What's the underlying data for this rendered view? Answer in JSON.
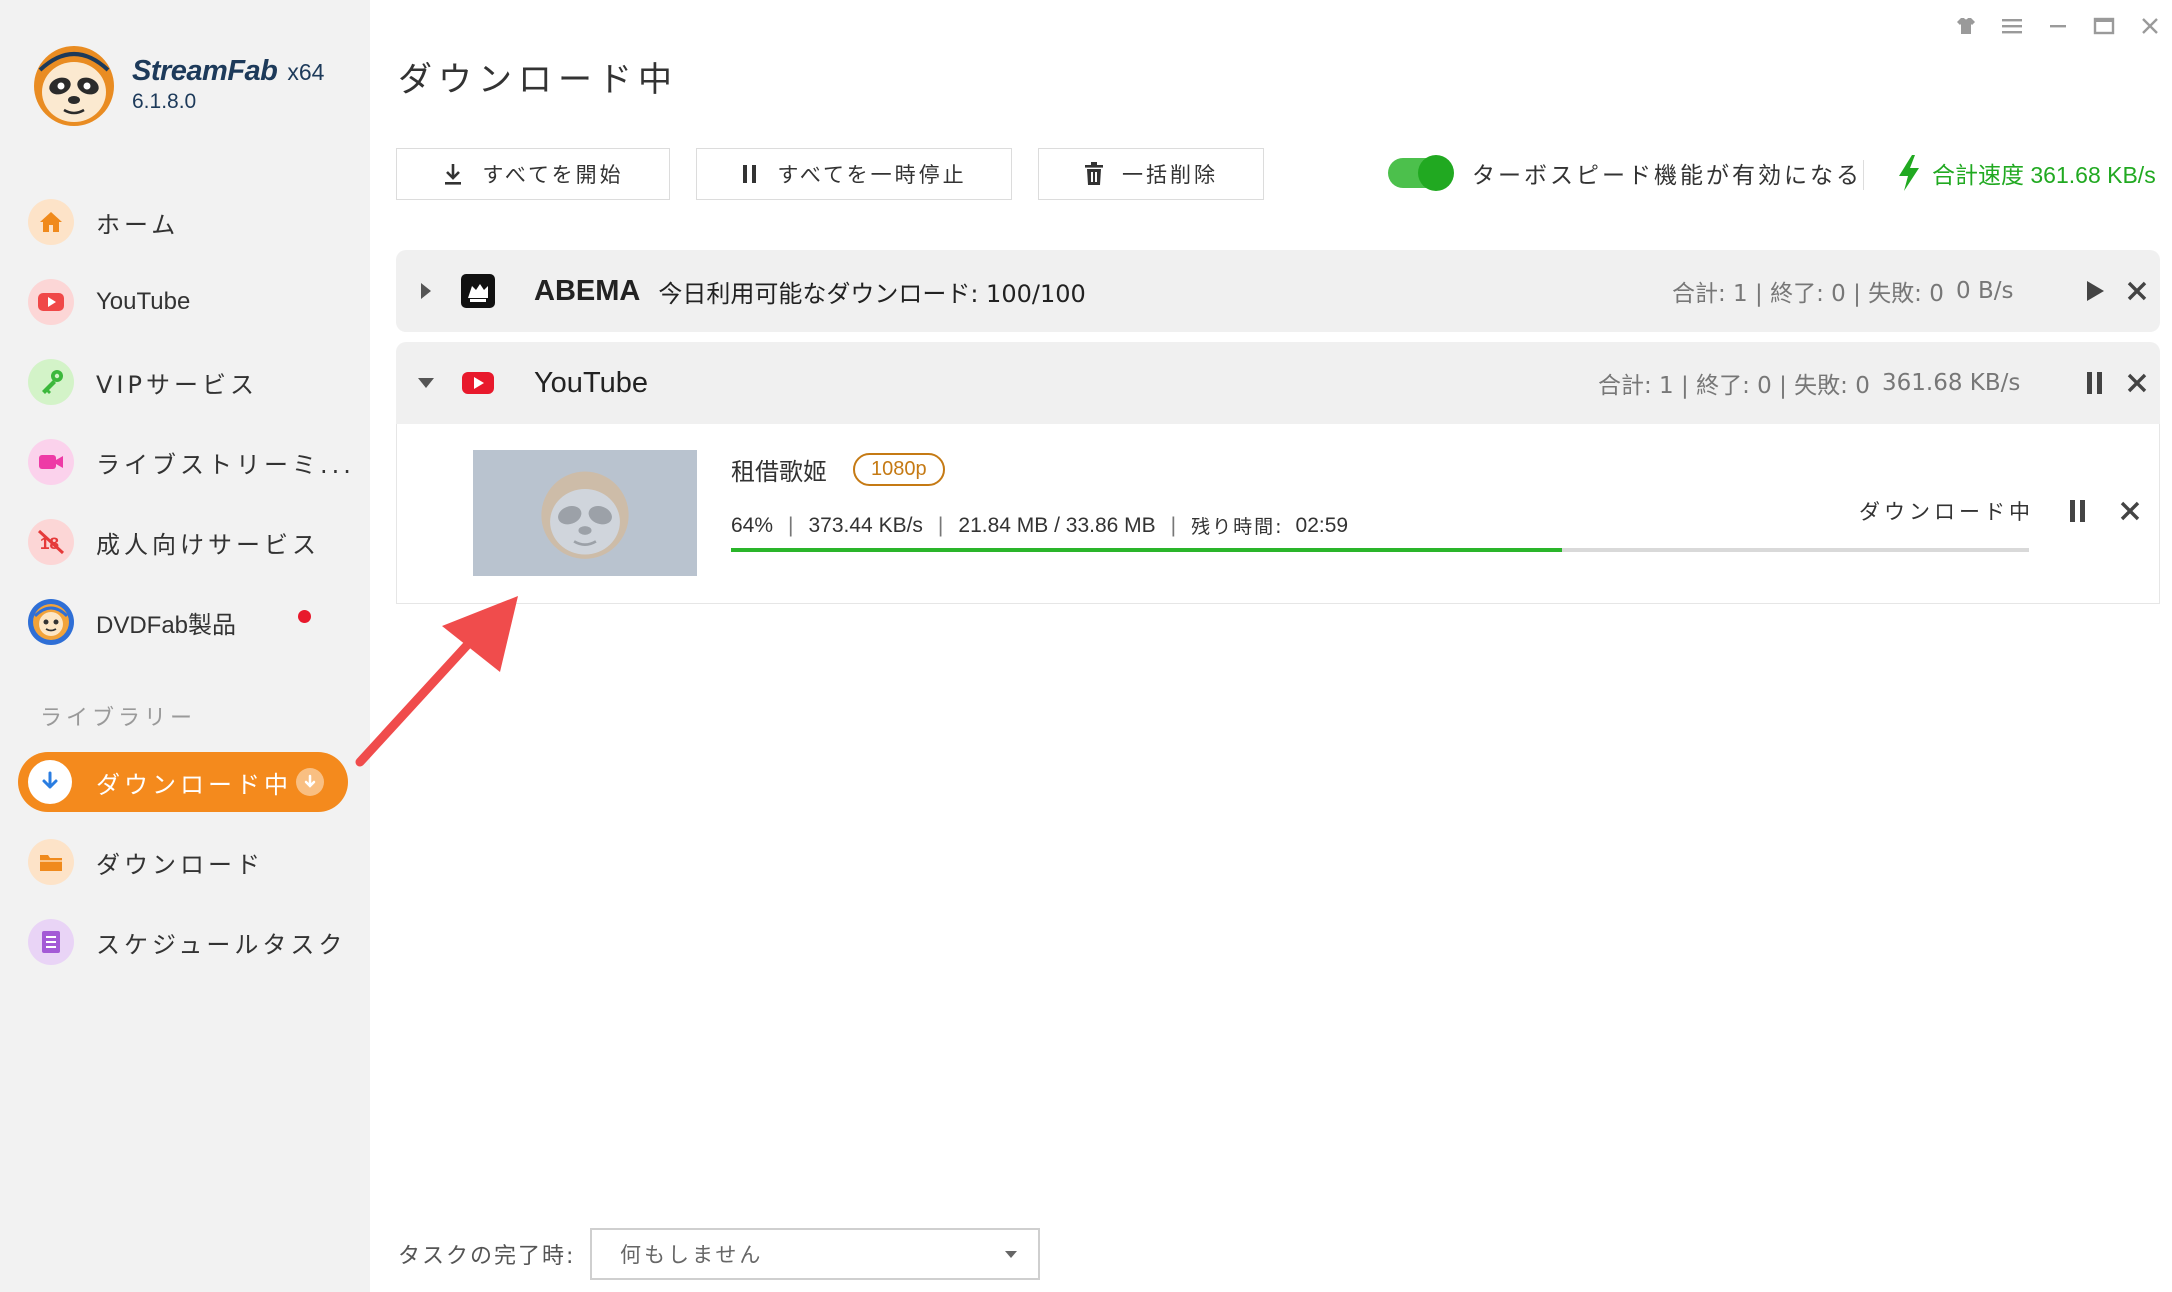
{
  "app": {
    "brand": "StreamFab",
    "arch": "x64",
    "version": "6.1.8.0"
  },
  "sidebar": {
    "items": [
      {
        "label": "ホーム",
        "icon": "home-icon"
      },
      {
        "label": "YouTube",
        "icon": "youtube-icon"
      },
      {
        "label": "VIPサービス",
        "icon": "key-icon"
      },
      {
        "label": "ライブストリーミ...",
        "icon": "video-camera-icon"
      },
      {
        "label": "成人向けサービス",
        "icon": "adult-18-icon"
      },
      {
        "label": "DVDFab製品",
        "icon": "dvdfab-icon"
      }
    ],
    "library_heading": "ライブラリー",
    "library": [
      {
        "label": "ダウンロード中",
        "icon": "download-arrow-icon",
        "active": true
      },
      {
        "label": "ダウンロード",
        "icon": "folder-icon"
      },
      {
        "label": "スケジュールタスク",
        "icon": "schedule-list-icon"
      }
    ]
  },
  "main": {
    "title": "ダウンロード中",
    "toolbar": {
      "start_all": "すべてを開始",
      "pause_all": "すべてを一時停止",
      "delete_all": "一括削除",
      "turbo_label": "ターボスピード機能が有効になる",
      "turbo_enabled": true,
      "total_speed": "合計速度 361.68 KB/s"
    },
    "groups": [
      {
        "name": "ABEMA",
        "quota": "今日利用可能なダウンロード: 100/100",
        "stats": "合計: 1 | 終了: 0 | 失敗: 0",
        "speed": "0 B/s",
        "expanded": false
      },
      {
        "name": "YouTube",
        "stats": "合計: 1 | 終了: 0 | 失敗: 0",
        "speed": "361.68 KB/s",
        "expanded": true
      }
    ],
    "task": {
      "name": "租借歌姬",
      "quality": "1080p",
      "percent": "64%",
      "speed": "373.44 KB/s",
      "size": "21.84 MB / 33.86 MB",
      "remaining_label": "残り時間:",
      "remaining": "02:59",
      "status": "ダウンロード中",
      "progress": 0.64
    },
    "footer": {
      "complete_label": "タスクの完了時:",
      "complete_action": "何もしません"
    }
  },
  "colors": {
    "accent": "#f48a1d",
    "green": "#21a921",
    "youtube_red": "#e8192c",
    "quality_badge": "#c57a14"
  }
}
